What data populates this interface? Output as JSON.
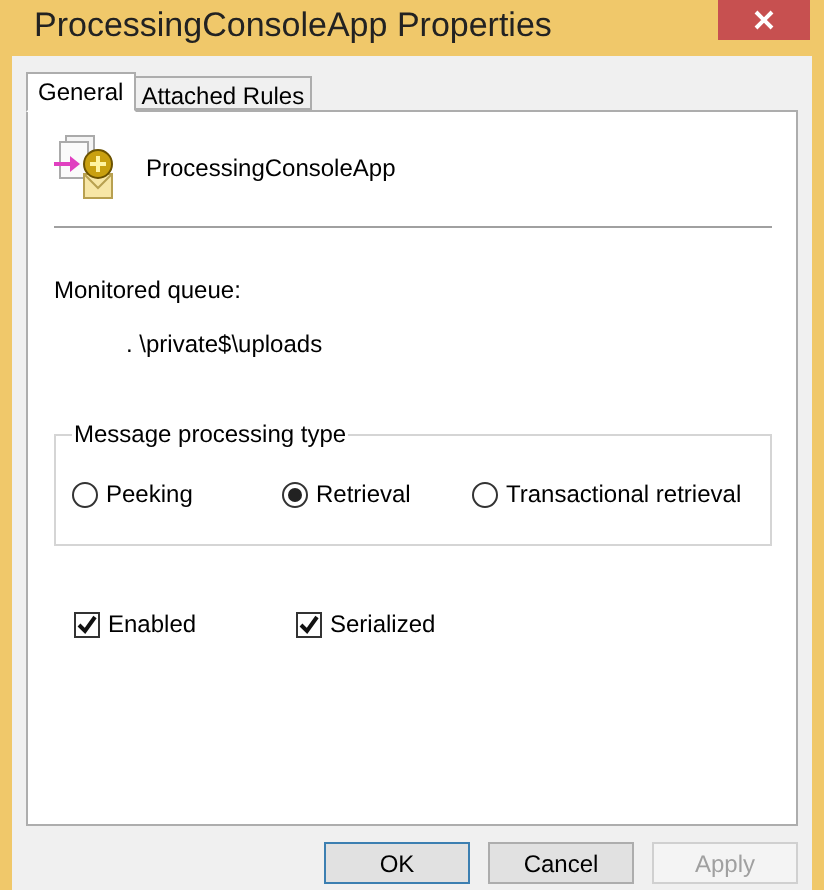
{
  "window": {
    "title": "ProcessingConsoleApp Properties"
  },
  "tabs": [
    {
      "label": "General",
      "selected": true
    },
    {
      "label": "Attached Rules",
      "selected": false
    }
  ],
  "general": {
    "app_name": "ProcessingConsoleApp",
    "queue_label": "Monitored queue:",
    "queue_value": ". \\private$\\uploads",
    "processing_type": {
      "legend": "Message processing type",
      "options": [
        {
          "label": "Peeking",
          "selected": false
        },
        {
          "label": "Retrieval",
          "selected": true
        },
        {
          "label": "Transactional retrieval",
          "selected": false
        }
      ]
    },
    "checkboxes": [
      {
        "label": "Enabled",
        "checked": true
      },
      {
        "label": "Serialized",
        "checked": true
      }
    ]
  },
  "buttons": [
    {
      "label": "OK",
      "disabled": false,
      "default": true
    },
    {
      "label": "Cancel",
      "disabled": false,
      "default": false
    },
    {
      "label": "Apply",
      "disabled": true,
      "default": false
    }
  ]
}
